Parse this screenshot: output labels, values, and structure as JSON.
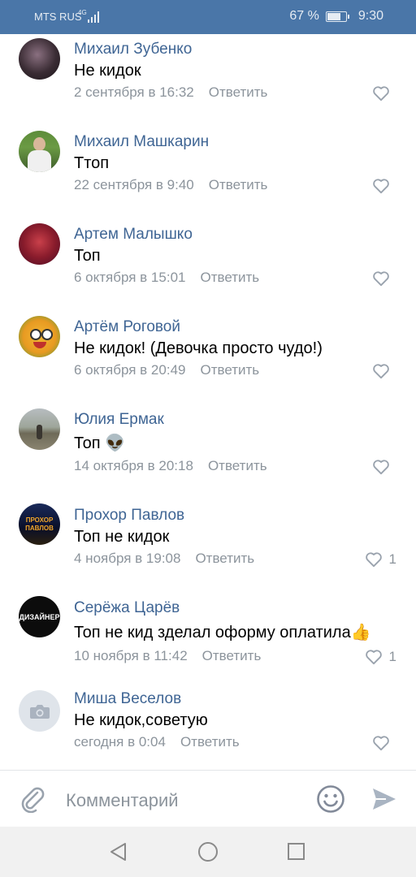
{
  "status": {
    "carrier": "MTS RUS",
    "network": "4G",
    "battery_percent": "67 %",
    "battery_level": 0.67,
    "time": "9:30"
  },
  "comments": [
    {
      "author": "Михаил Зубенко",
      "text": "Не кидок",
      "date": "2 сентября в 16:32",
      "reply": "Ответить",
      "likes": ""
    },
    {
      "author": "Михаил Машкарин",
      "text": "Ттоп",
      "date": "22 сентября в 9:40",
      "reply": "Ответить",
      "likes": ""
    },
    {
      "author": "Артем Малышко",
      "text": "Топ",
      "date": "6 октября в 15:01",
      "reply": "Ответить",
      "likes": ""
    },
    {
      "author": "Артём Роговой",
      "text": "Не кидок! (Девочка просто чудо!)",
      "date": "6 октября в 20:49",
      "reply": "Ответить",
      "likes": ""
    },
    {
      "author": "Юлия Ермак",
      "text": "Топ 👽",
      "date": "14 октября в 20:18",
      "reply": "Ответить",
      "likes": ""
    },
    {
      "author": "Прохор Павлов",
      "text": "Топ не кидок",
      "date": "4 ноября в 19:08",
      "reply": "Ответить",
      "likes": "1",
      "avatar_text": "ПРОХОР ПАВЛОВ"
    },
    {
      "author": "Серёжа Царёв",
      "text": "Топ не кид зделал оформу оплатила👍",
      "date": "10 ноября в 11:42",
      "reply": "Ответить",
      "likes": "1",
      "avatar_text": "ДИЗАЙНЕР"
    },
    {
      "author": "Миша Веселов",
      "text": "Не кидок,советую",
      "date": "сегодня в 0:04",
      "reply": "Ответить",
      "likes": ""
    }
  ],
  "input": {
    "placeholder": "Комментарий"
  },
  "icons": {
    "attach": "paperclip-icon",
    "emoji": "smiley-icon",
    "send": "send-icon",
    "like": "heart-icon",
    "back": "back-triangle-icon",
    "home": "home-circle-icon",
    "recents": "recents-square-icon"
  },
  "colors": {
    "header": "#4a76a8",
    "author": "#3f6594",
    "meta": "#8c949c"
  }
}
